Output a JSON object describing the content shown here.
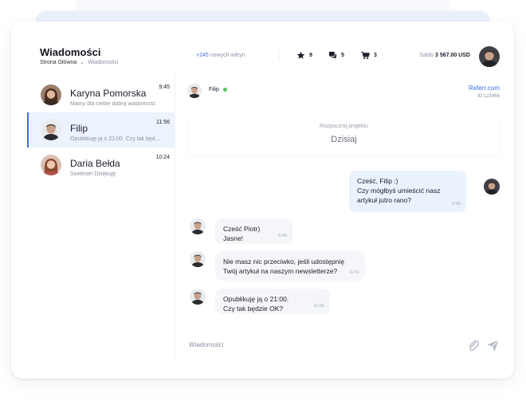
{
  "header": {
    "title": "Wiadomości",
    "breadcrumb": [
      "Strona Główna",
      "Wiadomości"
    ],
    "new_sites_count": "+245",
    "new_sites_label": "nowych witryn",
    "stats": [
      {
        "icon": "star-icon",
        "value": "9"
      },
      {
        "icon": "chat-bubbles-icon",
        "value": "5"
      },
      {
        "icon": "cart-icon",
        "value": "3"
      }
    ],
    "balance_label": "Saldo",
    "balance_value": "3 567.00 USD"
  },
  "conversations": [
    {
      "name": "Karyna Pomorska",
      "preview": "Mamy dla ciebie dobrą wiadomość",
      "time": "9:45",
      "active": false
    },
    {
      "name": "Filip",
      "preview": "Opublikuję ją o 21:00. Czy tak będzie OK?",
      "time": "11:56",
      "active": true
    },
    {
      "name": "Daria Bełda",
      "preview": "Świetnie! Dziękuję",
      "time": "10:24",
      "active": false
    }
  ],
  "chat": {
    "contact_name": "Filip",
    "ref_link": "Referr.com",
    "ref_id": "ID 123456",
    "project_label": "Rozpocznij projektu",
    "date_label": "Dzisiaj",
    "messages": [
      {
        "dir": "out",
        "text": "Cześć, Filip :)\nCzy mógłbyś umieścić nasz\nartykuł jutro rano?",
        "time": "9:45"
      },
      {
        "dir": "in",
        "text": "Cześć Piotr)\nJasne!",
        "time": "9:45"
      },
      {
        "dir": "in",
        "text": "Nie masz nic przeciwko, jeśli udostępnię\nTwój artykuł na naszym newsletterze?",
        "time": "11:56"
      },
      {
        "dir": "in",
        "text": "Opublikuję ją o 21:00.\nCzy tak będzie OK?",
        "time": "11:56"
      }
    ],
    "compose_placeholder": "Wiadomości"
  },
  "colors": {
    "accent": "#3f6fd6",
    "online": "#5bc46a",
    "active_row": "#edf3fc",
    "out_bubble": "#eaf2fd",
    "in_bubble": "#f5f6f9"
  }
}
